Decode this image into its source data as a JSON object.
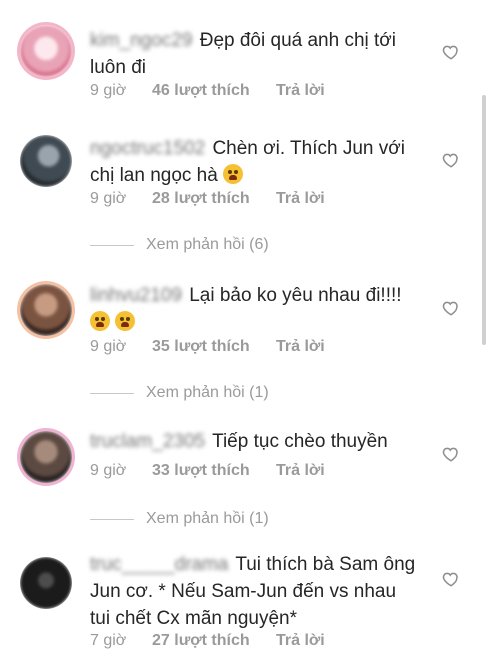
{
  "comments": [
    {
      "username": "kim_ngoc29",
      "text": "Đẹp đôi quá anh chị tới luôn đi",
      "time": "9 giờ",
      "likes": "46 lượt thích",
      "reply": "Trả lời",
      "emoji": []
    },
    {
      "username": "ngoctruc1502",
      "text": "Chèn ơi. Thích Jun với chị lan ngọc hà",
      "time": "9 giờ",
      "likes": "28 lượt thích",
      "reply": "Trả lời",
      "view_replies": "Xem phản hồi (6)"
    },
    {
      "username": "linhvu2109",
      "text": "Lại bảo ko yêu nhau đi!!!!",
      "time": "9 giờ",
      "likes": "35 lượt thích",
      "reply": "Trả lời",
      "view_replies": "Xem phản hồi (1)"
    },
    {
      "username": "truclam_2305",
      "text": "Tiếp tục chèo thuyền",
      "time": "9 giờ",
      "likes": "33 lượt thích",
      "reply": "Trả lời",
      "view_replies": "Xem phản hồi (1)"
    },
    {
      "username": "truc_____drama",
      "text": "Tui thích bà Sam ông Jun cơ. * Nếu Sam-Jun đến vs nhau tui chết Cx mãn nguyện*",
      "time": "7 giờ",
      "likes": "27 lượt thích",
      "reply": "Trả lời"
    }
  ],
  "icons": {
    "like": "heart-outline-icon",
    "emoji": "face-emoji-icon"
  }
}
